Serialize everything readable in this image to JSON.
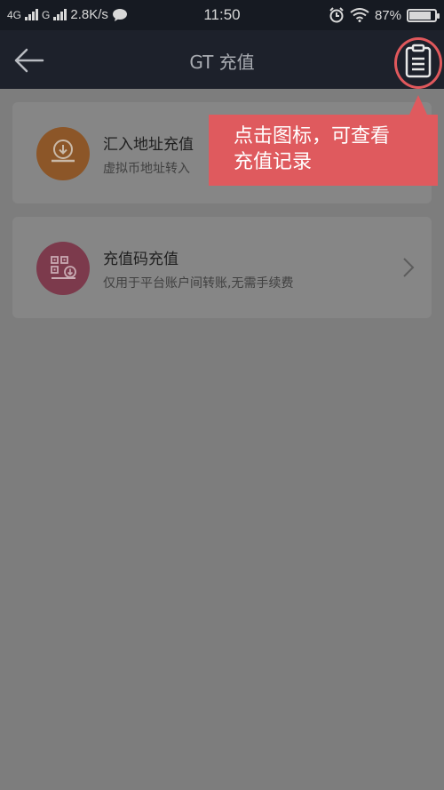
{
  "status_bar": {
    "network1": "4G",
    "network2": "G",
    "speed": "2.8K/s",
    "time": "11:50",
    "battery": "87%",
    "battery_level": 0.87
  },
  "nav": {
    "title": "GT 充值",
    "back_icon": "back-arrow-icon",
    "records_icon": "clipboard-icon"
  },
  "cards": {
    "address": {
      "title": "汇入地址充值",
      "desc": "虚拟币地址转入",
      "icon": "download-icon",
      "icon_color": "#d6843f"
    },
    "code": {
      "title": "充值码充值",
      "desc": "仅用于平台账户间转账,无需手续费",
      "icon": "qr-download-icon",
      "icon_color": "#b9506d"
    }
  },
  "tooltip": {
    "line1": "点击图标，可查看",
    "line2": "充值记录",
    "color": "#df5a5e"
  }
}
